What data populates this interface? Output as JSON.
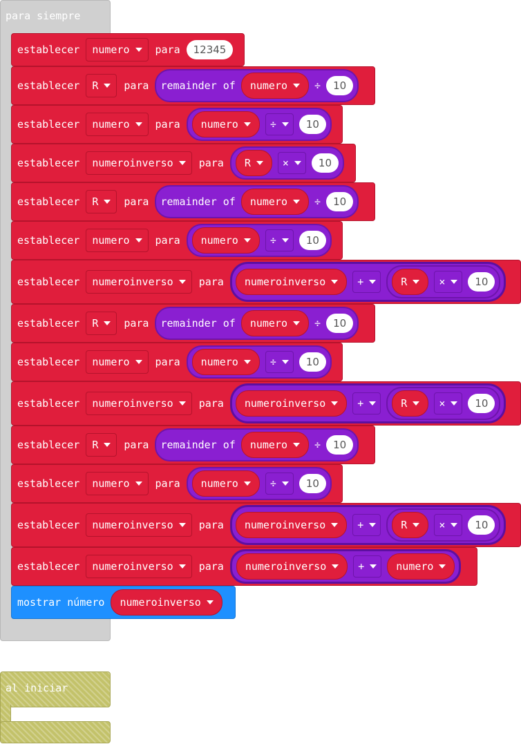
{
  "forever": {
    "label": "para siempre",
    "blocks": [
      {
        "kw": "establecer",
        "var": "numero",
        "para": "para",
        "value": "12345"
      },
      {
        "kw": "establecer",
        "var": "R",
        "para": "para",
        "rem": "remainder of",
        "arg": "numero",
        "op": "÷",
        "num": "10"
      },
      {
        "kw": "establecer",
        "var": "numero",
        "para": "para",
        "arg": "numero",
        "op": "÷",
        "num": "10"
      },
      {
        "kw": "establecer",
        "var": "numeroinverso",
        "para": "para",
        "arg": "R",
        "op": "×",
        "num": "10"
      },
      {
        "kw": "establecer",
        "var": "R",
        "para": "para",
        "rem": "remainder of",
        "arg": "numero",
        "op": "÷",
        "num": "10"
      },
      {
        "kw": "establecer",
        "var": "numero",
        "para": "para",
        "arg": "numero",
        "op": "÷",
        "num": "10"
      },
      {
        "kw": "establecer",
        "var": "numeroinverso",
        "para": "para",
        "arg": "numeroinverso",
        "op": "+",
        "arg2": "R",
        "op2": "×",
        "num": "10"
      },
      {
        "kw": "establecer",
        "var": "R",
        "para": "para",
        "rem": "remainder of",
        "arg": "numero",
        "op": "÷",
        "num": "10"
      },
      {
        "kw": "establecer",
        "var": "numero",
        "para": "para",
        "arg": "numero",
        "op": "÷",
        "num": "10"
      },
      {
        "kw": "establecer",
        "var": "numeroinverso",
        "para": "para",
        "arg": "numeroinverso",
        "op": "+",
        "arg2": "R",
        "op2": "×",
        "num": "10"
      },
      {
        "kw": "establecer",
        "var": "R",
        "para": "para",
        "rem": "remainder of",
        "arg": "numero",
        "op": "÷",
        "num": "10"
      },
      {
        "kw": "establecer",
        "var": "numero",
        "para": "para",
        "arg": "numero",
        "op": "÷",
        "num": "10"
      },
      {
        "kw": "establecer",
        "var": "numeroinverso",
        "para": "para",
        "arg": "numeroinverso",
        "op": "+",
        "arg2": "R",
        "op2": "×",
        "num": "10"
      },
      {
        "kw": "establecer",
        "var": "numeroinverso",
        "para": "para",
        "arg": "numeroinverso",
        "op": "+",
        "arg2": "numero"
      }
    ],
    "show": {
      "kw": "mostrar número",
      "arg": "numeroinverso"
    }
  },
  "on_start": {
    "label": "al iniciar"
  },
  "colors": {
    "variables": "#e01e3c",
    "math": "#8a1fd1",
    "basic": "#1e90ff",
    "loops": "#d0d0d0",
    "on_start": "#c3c26a"
  }
}
